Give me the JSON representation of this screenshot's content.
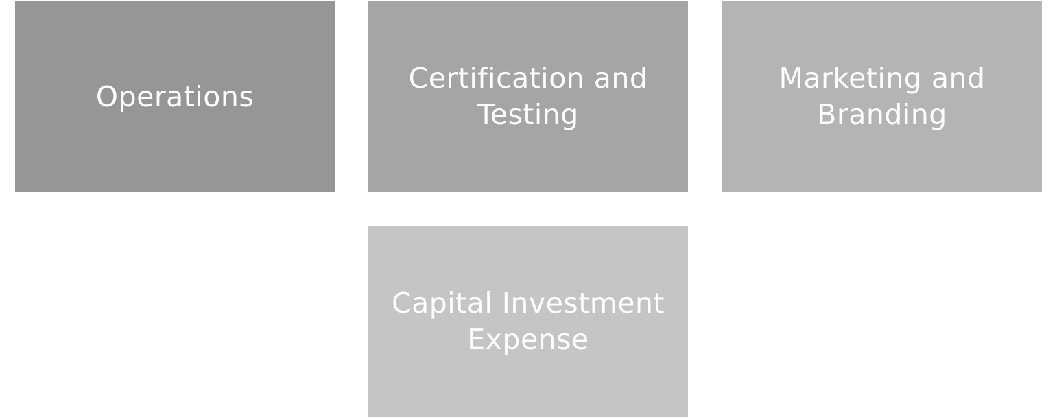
{
  "tiles": [
    {
      "lines": [
        "Operations"
      ],
      "color": "#969696"
    },
    {
      "lines": [
        "Certification and",
        "Testing"
      ],
      "color": "#a5a5a5"
    },
    {
      "lines": [
        "Marketing and",
        "Branding"
      ],
      "color": "#b4b4b4"
    },
    {
      "lines": [
        "Capital Investment",
        "Expense"
      ],
      "color": "#c5c5c5"
    }
  ]
}
